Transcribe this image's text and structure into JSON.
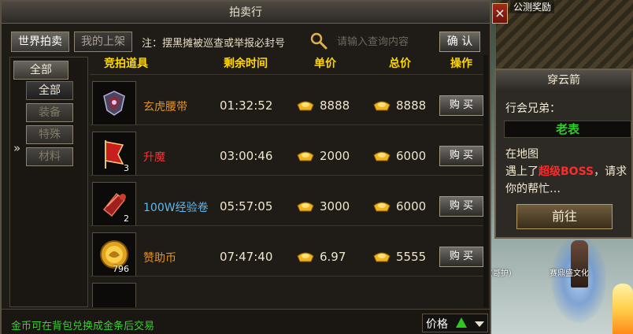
{
  "window_title": "拍卖行",
  "tabs": [
    {
      "label": "世界拍卖",
      "state": "active"
    },
    {
      "label": "我的上架",
      "state": "inactive"
    }
  ],
  "notice": "注：摆黑摊被巡查或举报必封号",
  "search": {
    "placeholder": "请输入查询内容",
    "confirm_label": "确 认"
  },
  "sidebar": {
    "top_label": "全部",
    "items": [
      {
        "label": "全部",
        "selected": true
      },
      {
        "label": "装备",
        "selected": false
      },
      {
        "label": "特殊",
        "selected": false
      },
      {
        "label": "材料",
        "selected": false
      }
    ]
  },
  "columns": [
    "竞拍道具",
    "剩余时间",
    "单价",
    "总价",
    "操作"
  ],
  "rows": [
    {
      "name": "玄虎腰带",
      "name_color": "#e0922a",
      "count": "",
      "time": "01:32:52",
      "price": "8888",
      "total": "8888",
      "action": "购 买",
      "icon": "belt-icon"
    },
    {
      "name": "升魔",
      "name_color": "#ff3030",
      "count": "3",
      "time": "03:00:46",
      "price": "2000",
      "total": "6000",
      "action": "购 买",
      "icon": "flag-icon"
    },
    {
      "name": "100W经验卷",
      "name_color": "#5fb8f0",
      "count": "2",
      "time": "05:57:05",
      "price": "3000",
      "total": "6000",
      "action": "购 买",
      "icon": "scroll-icon"
    },
    {
      "name": "赞助币",
      "name_color": "#e0922a",
      "count": "796",
      "time": "07:47:40",
      "price": "6.97",
      "total": "5555",
      "action": "购 买",
      "icon": "coin-icon"
    }
  ],
  "footer": {
    "note": "金币可在背包兑换成金条后交易",
    "sort_label": "价格"
  },
  "popup": {
    "title": "穿云箭",
    "greeting": "行会兄弟：",
    "name": "老表",
    "msg_pre": "在地图",
    "msg_line2_pre": "遇上了",
    "boss": "超级BOSS",
    "msg_after": "，请求你的帮忙…",
    "button": "前往"
  },
  "world": {
    "top_label": "公测奖励",
    "char_name": "赛鼎盛文化",
    "char_name2": "(哥护)"
  },
  "close_symbol": "×"
}
